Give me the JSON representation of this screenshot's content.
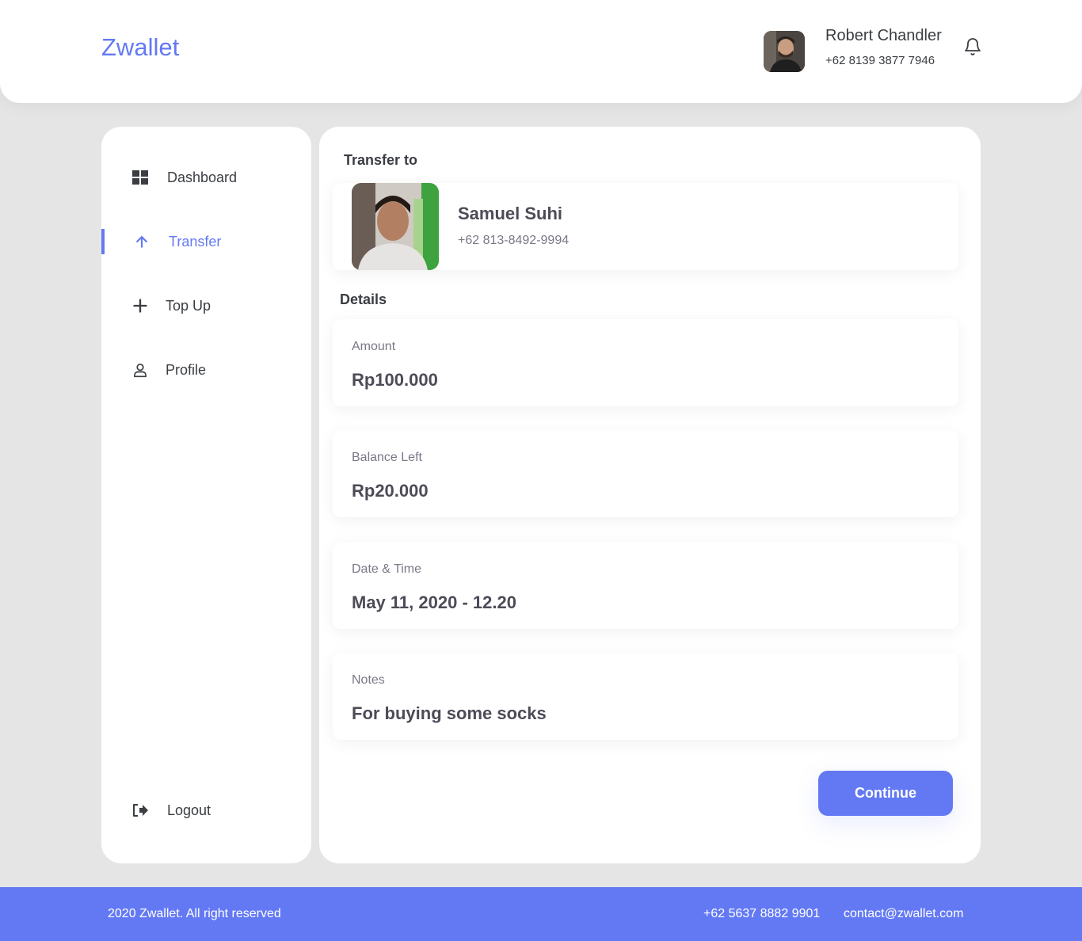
{
  "header": {
    "brand": "Zwallet",
    "user": {
      "name": "Robert Chandler",
      "phone": "+62 8139 3877 7946"
    }
  },
  "sidebar": {
    "items": [
      {
        "label": "Dashboard",
        "icon": "dashboard-grid-icon"
      },
      {
        "label": "Transfer",
        "icon": "arrow-up-icon",
        "active": true
      },
      {
        "label": "Top Up",
        "icon": "plus-icon"
      },
      {
        "label": "Profile",
        "icon": "user-icon"
      }
    ],
    "logout": {
      "label": "Logout",
      "icon": "logout-icon"
    }
  },
  "main": {
    "transfer_to_title": "Transfer to",
    "receiver": {
      "name": "Samuel Suhi",
      "phone": "+62 813-8492-9994"
    },
    "details_title": "Details",
    "details": [
      {
        "label": "Amount",
        "value": "Rp100.000"
      },
      {
        "label": "Balance Left",
        "value": "Rp20.000"
      },
      {
        "label": "Date & Time",
        "value": "May 11, 2020 - 12.20"
      },
      {
        "label": "Notes",
        "value": "For buying some socks"
      }
    ],
    "continue_label": "Continue"
  },
  "footer": {
    "copyright": "2020 Zwallet. All right reserved",
    "phone": "+62 5637 8882 9901",
    "email": "contact@zwallet.com"
  },
  "colors": {
    "accent": "#6379f4",
    "background": "#e5e5e5",
    "text_primary": "#3a3d42",
    "text_secondary": "#7a7886"
  }
}
